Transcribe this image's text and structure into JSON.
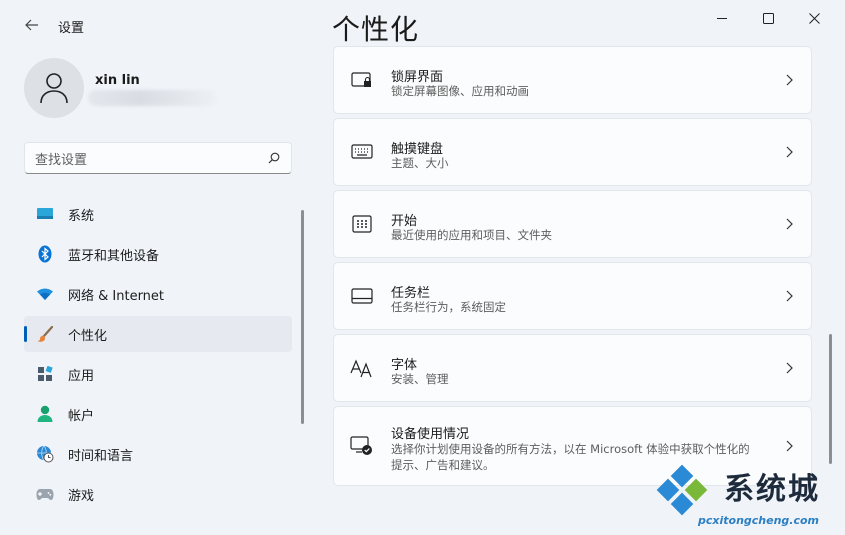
{
  "app": {
    "title": "设置"
  },
  "page": {
    "title": "个性化"
  },
  "user": {
    "name": "xin lin"
  },
  "search": {
    "placeholder": "查找设置"
  },
  "sidebar": {
    "items": [
      {
        "label": "系统",
        "icon": "system-display-icon",
        "active": false
      },
      {
        "label": "蓝牙和其他设备",
        "icon": "bluetooth-icon",
        "active": false
      },
      {
        "label": "网络 & Internet",
        "icon": "wifi-icon",
        "active": false
      },
      {
        "label": "个性化",
        "icon": "paintbrush-icon",
        "active": true
      },
      {
        "label": "应用",
        "icon": "apps-icon",
        "active": false
      },
      {
        "label": "帐户",
        "icon": "account-icon",
        "active": false
      },
      {
        "label": "时间和语言",
        "icon": "globe-clock-icon",
        "active": false
      },
      {
        "label": "游戏",
        "icon": "gamepad-icon",
        "active": false
      }
    ]
  },
  "main": {
    "cards": [
      {
        "title": "锁屏界面",
        "subtitle": "锁定屏幕图像、应用和动画",
        "icon": "lock-screen-icon"
      },
      {
        "title": "触摸键盘",
        "subtitle": "主题、大小",
        "icon": "keyboard-icon"
      },
      {
        "title": "开始",
        "subtitle": "最近使用的应用和项目、文件夹",
        "icon": "start-menu-icon"
      },
      {
        "title": "任务栏",
        "subtitle": "任务栏行为，系统固定",
        "icon": "taskbar-icon"
      },
      {
        "title": "字体",
        "subtitle": "安装、管理",
        "icon": "fonts-icon"
      },
      {
        "title": "设备使用情况",
        "subtitle_line1": "选择你计划使用设备的所有方法，以在 Microsoft 体验中获取个性化的",
        "subtitle_line2": "提示、广告和建议。",
        "icon": "device-usage-icon"
      }
    ]
  },
  "watermark": {
    "text": "系统城",
    "url": "pcxitongcheng.com"
  },
  "colors": {
    "accent": "#005fb8",
    "background": "#f0f4f9",
    "card": "#fbfcfd"
  }
}
